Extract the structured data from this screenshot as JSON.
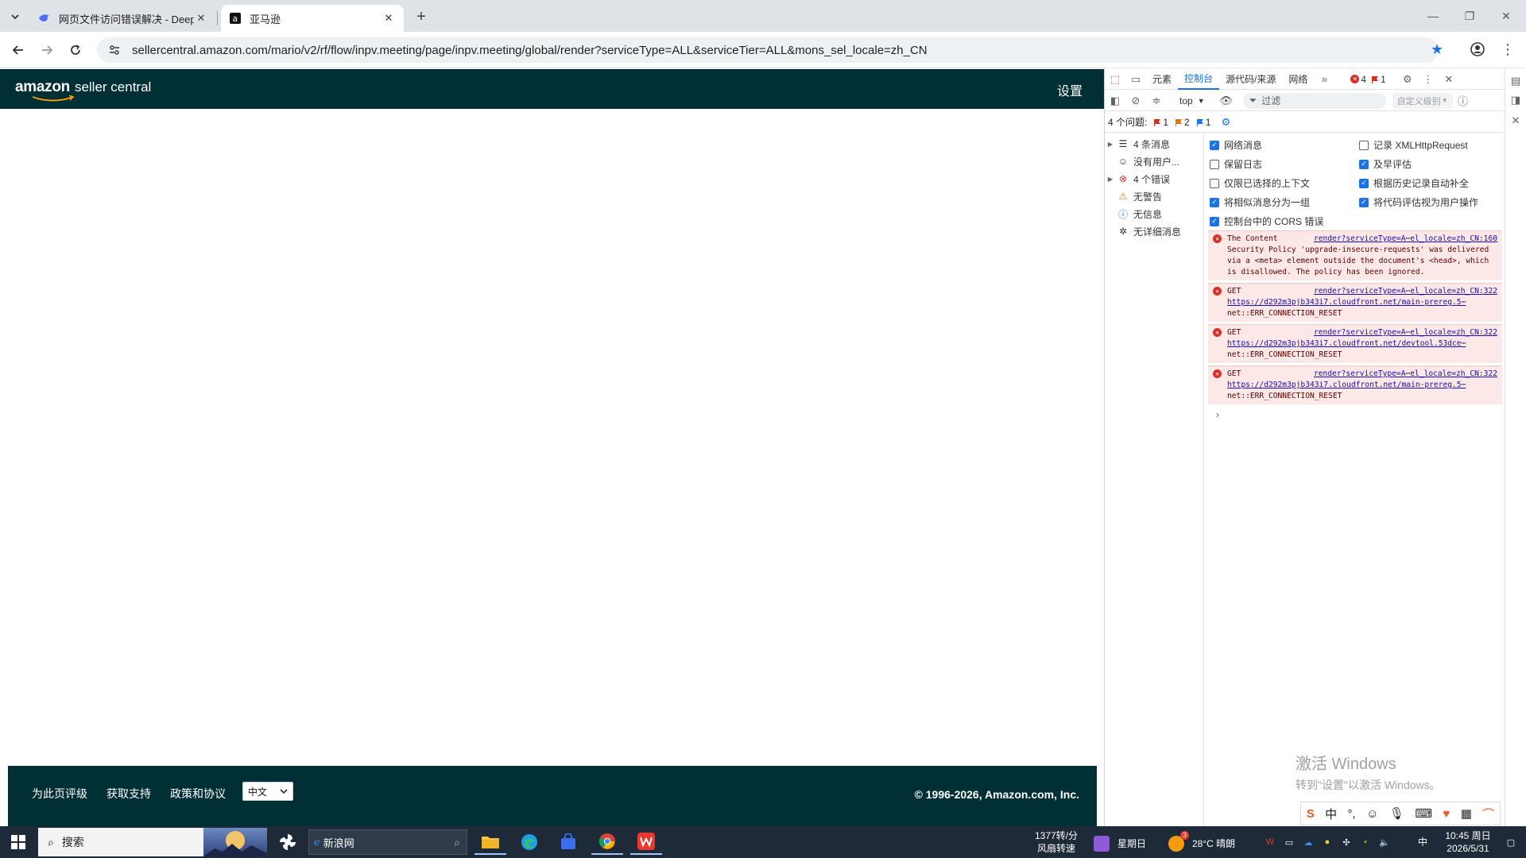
{
  "browser": {
    "tabs": [
      {
        "title": "网页文件访问错误解决 - DeepSeek",
        "active": false
      },
      {
        "title": "亚马逊",
        "active": true
      }
    ],
    "new_tab_label": "+",
    "url": "sellercentral.amazon.com/mario/v2/rf/flow/inpv.meeting/page/inpv.meeting/global/render?serviceType=ALL&serviceTier=ALL&mons_sel_locale=zh_CN"
  },
  "page": {
    "logo_brand": "amazon",
    "logo_product": "seller central",
    "settings_label": "设置",
    "footer": {
      "links": [
        "为此页评级",
        "获取支持",
        "政策和协议"
      ],
      "language": "中文",
      "copyright": "© 1996-2026, Amazon.com, Inc."
    }
  },
  "devtools": {
    "tabs": [
      "元素",
      "控制台",
      "源代码/来源",
      "网络"
    ],
    "active_tab": "控制台",
    "error_count": "4",
    "issue_flag_count": "1",
    "context": "top",
    "filter_placeholder": "过滤",
    "level_label": "自定义级别",
    "issues_label": "4 个问题:",
    "issue_counts": [
      "1",
      "2",
      "1"
    ],
    "sidebar": [
      {
        "label": "4 条消息",
        "icon": "list-icon",
        "expandable": true
      },
      {
        "label": "没有用户...",
        "icon": "user-icon",
        "expandable": false
      },
      {
        "label": "4 个错误",
        "icon": "error-icon",
        "expandable": true
      },
      {
        "label": "无警告",
        "icon": "warning-icon",
        "expandable": false
      },
      {
        "label": "无信息",
        "icon": "info-icon",
        "expandable": false
      },
      {
        "label": "无详细消息",
        "icon": "bug-icon",
        "expandable": false
      }
    ],
    "settings": [
      {
        "label": "网络消息",
        "checked": true
      },
      {
        "label": "记录 XMLHttpRequest",
        "checked": false
      },
      {
        "label": "保留日志",
        "checked": false
      },
      {
        "label": "及早评估",
        "checked": true
      },
      {
        "label": "仅限已选择的上下文",
        "checked": false
      },
      {
        "label": "根据历史记录自动补全",
        "checked": true
      },
      {
        "label": "将相似消息分为一组",
        "checked": true
      },
      {
        "label": "将代码评估视为用户操作",
        "checked": true
      },
      {
        "label": "控制台中的 CORS 错误",
        "checked": true
      }
    ],
    "logs": [
      {
        "head": "The Content",
        "source": "render?serviceType=A⋯el_locale=zh_CN:160",
        "body": "Security Policy 'upgrade-insecure-requests' was delivered via a <meta> element outside the document's <head>, which is disallowed. The policy has been ignored."
      },
      {
        "head": "GET",
        "source": "render?serviceType=A⋯el_locale=zh_CN:322",
        "link": "https://d292m3pjb343i7.cloudfront.net/main-prereg.5⋯",
        "error": "net::ERR_CONNECTION_RESET"
      },
      {
        "head": "GET",
        "source": "render?serviceType=A⋯el_locale=zh_CN:322",
        "link": "https://d292m3pjb343i7.cloudfront.net/devtool.53dce⋯",
        "error": "net::ERR_CONNECTION_RESET"
      },
      {
        "head": "GET",
        "source": "render?serviceType=A⋯el_locale=zh_CN:322",
        "link": "https://d292m3pjb343i7.cloudfront.net/main-prereg.5⋯",
        "error": "net::ERR_CONNECTION_RESET"
      }
    ]
  },
  "watermark": {
    "line1": "激活 Windows",
    "line2": "转到\"设置\"以激活 Windows。"
  },
  "taskbar": {
    "search_placeholder": "搜索",
    "news_label": "新浪网",
    "fan_speed": "1377转/分",
    "fan_mode": "风扇转速",
    "weekday_chip": "星期日",
    "weather": "28°C 晴朗",
    "weather_badge": "3",
    "ime_lang": "中",
    "time": "10:45 周日",
    "date": "2026/5/31"
  },
  "colors": {
    "seller_central_bg": "#002f36",
    "devtools_active": "#1a73e8",
    "error_bg": "#fce8e6",
    "taskbar_bg": "#1f2a38"
  }
}
